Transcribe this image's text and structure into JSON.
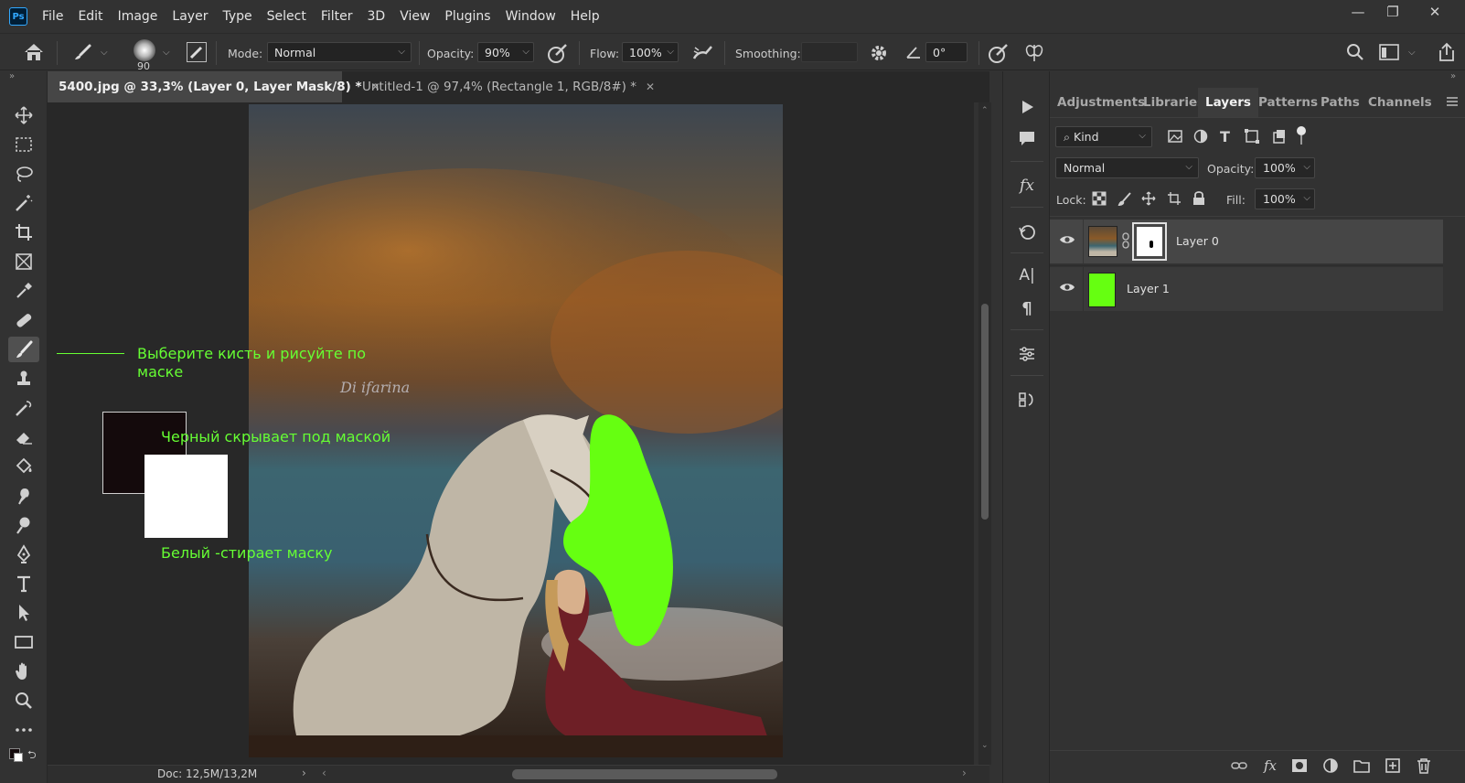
{
  "app": {
    "logo": "Ps"
  },
  "menu": [
    "File",
    "Edit",
    "Image",
    "Layer",
    "Type",
    "Select",
    "Filter",
    "3D",
    "View",
    "Plugins",
    "Window",
    "Help"
  ],
  "window_controls": {
    "minimize": "—",
    "restore": "❐",
    "close": "✕"
  },
  "options_bar": {
    "brush_size": "90",
    "mode_label": "Mode:",
    "mode_value": "Normal",
    "opacity_label": "Opacity:",
    "opacity_value": "90%",
    "flow_label": "Flow:",
    "flow_value": "100%",
    "smoothing_label": "Smoothing:",
    "angle_value": "0°"
  },
  "tabs": [
    {
      "label": "5400.jpg @ 33,3% (Layer 0, Layer Mask/8) *",
      "active": true
    },
    {
      "label": "Untitled-1 @ 97,4% (Rectangle 1, RGB/8#) *",
      "active": false
    }
  ],
  "annotations": {
    "brush_tip_line1": "Выберите кисть и рисуйте по",
    "brush_tip_line2": "маске",
    "black_tip": "Черный скрывает под маской",
    "white_tip": "Белый -стирает маску"
  },
  "watermark": "Di ifarina",
  "status": {
    "doc": "Doc: 12,5M/13,2M"
  },
  "panel": {
    "tabs": [
      "Adjustments",
      "Libraries",
      "Layers",
      "Patterns",
      "Paths",
      "Channels"
    ],
    "active_tab": "Layers",
    "filter_kind": "Kind",
    "blend_mode": "Normal",
    "opacity_label": "Opacity:",
    "opacity_value": "100%",
    "lock_label": "Lock:",
    "fill_label": "Fill:",
    "fill_value": "100%",
    "layers": [
      {
        "name": "Layer 0",
        "selected": true,
        "has_mask": true
      },
      {
        "name": "Layer 1",
        "selected": false,
        "fill_color": "#66ff11"
      }
    ]
  },
  "colors": {
    "accent_green": "#66ff33",
    "layer1_fill": "#66ff11",
    "foreground": "#140a0c",
    "background": "#ffffff"
  }
}
